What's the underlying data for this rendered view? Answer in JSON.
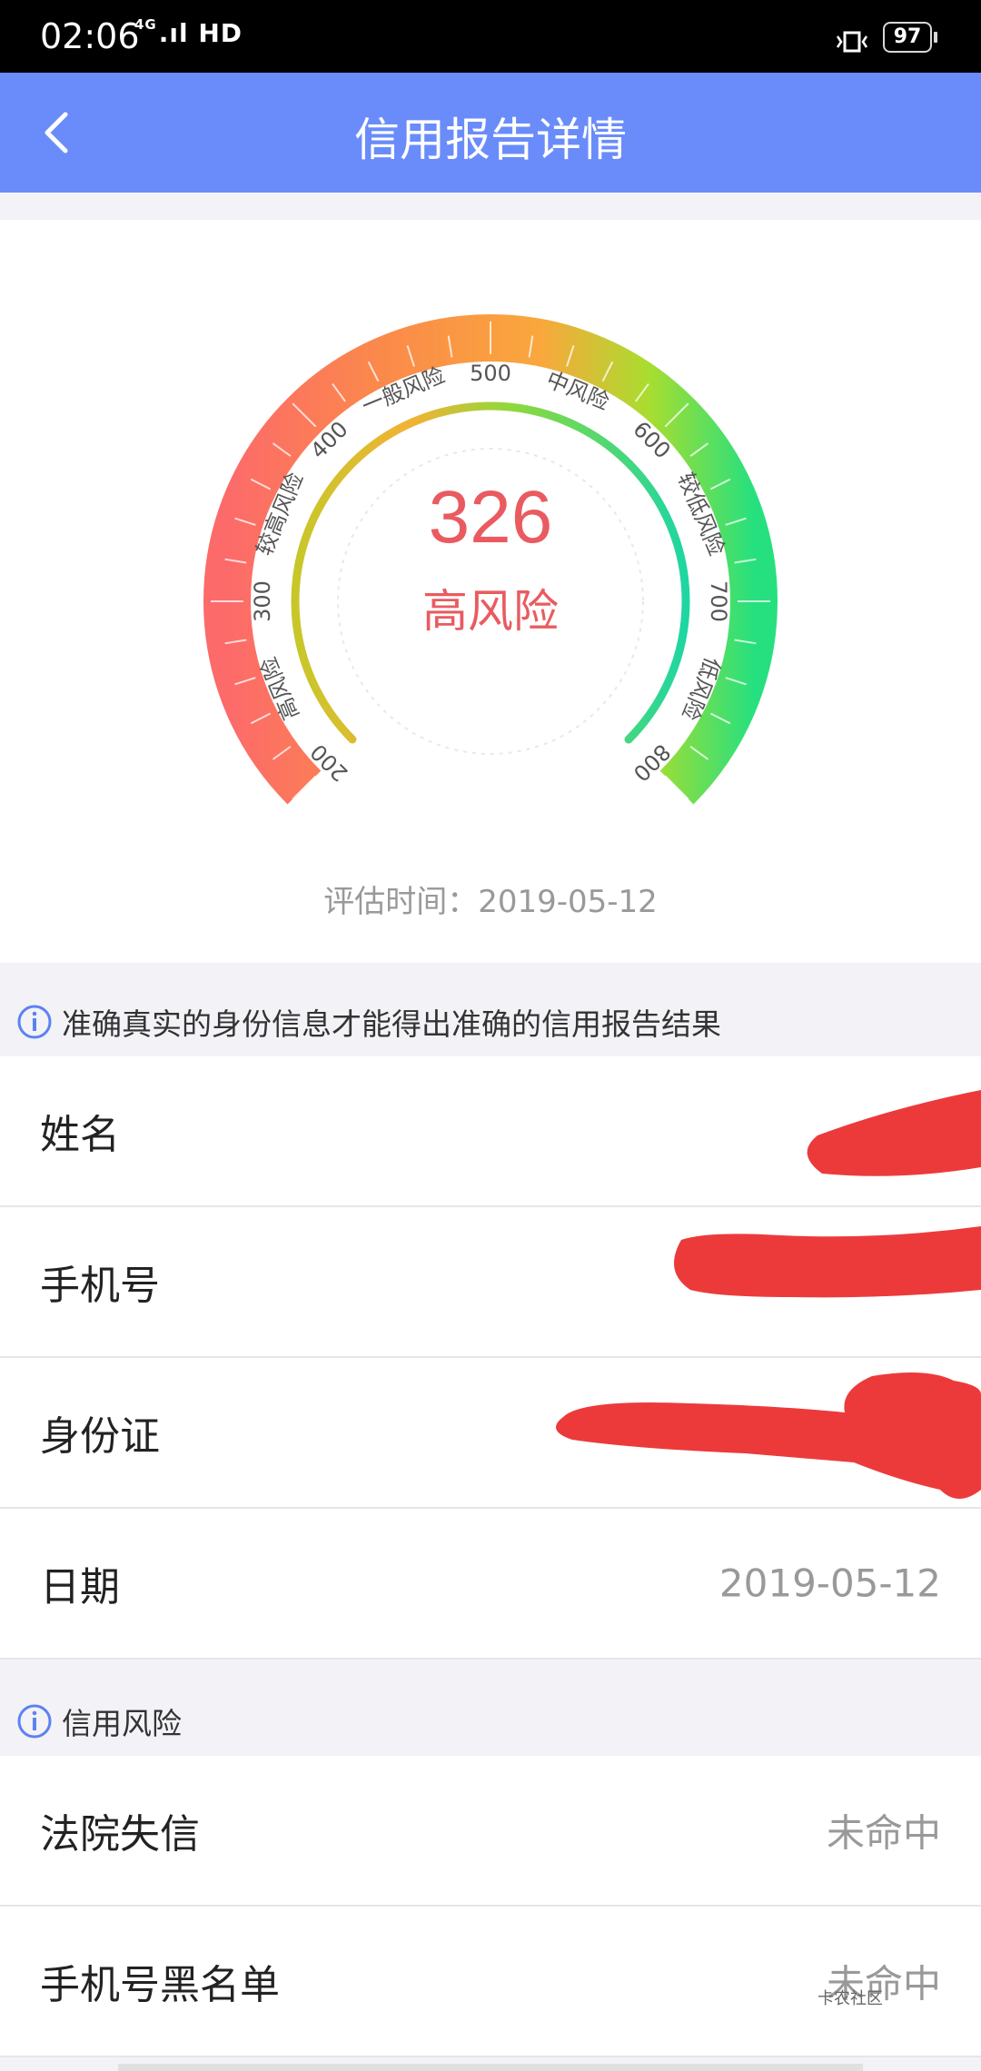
{
  "status": {
    "time": "02:06",
    "network": "4G",
    "hd": "HD",
    "battery": "97"
  },
  "header": {
    "title": "信用报告详情"
  },
  "gauge": {
    "score": "326",
    "risk": "高风险",
    "scale_ticks": [
      "200",
      "300",
      "400",
      "500",
      "600",
      "700",
      "800"
    ],
    "risk_bands": [
      "高风险",
      "较高风险",
      "一般风险",
      "中风险",
      "较低风险",
      "低风险"
    ],
    "eval_label": "评估时间：2019-05-12",
    "gradient_colors": [
      "#fb6e6e",
      "#fb9a44",
      "#f9b33d",
      "#a6e033",
      "#2fe27f"
    ]
  },
  "notice_identity": "准确真实的身份信息才能得出准确的信用报告结果",
  "identity_rows": [
    {
      "label": "姓名",
      "value": ""
    },
    {
      "label": "手机号",
      "value": ""
    },
    {
      "label": "身份证",
      "value": ""
    },
    {
      "label": "日期",
      "value": "2019-05-12"
    }
  ],
  "notice_risk": "信用风险",
  "risk_rows": [
    {
      "label": "法院失信",
      "value": "未命中"
    },
    {
      "label": "手机号黑名单",
      "value": "未命中"
    }
  ],
  "watermark": "卡农社区",
  "colors": {
    "header": "#6a8cfa",
    "score": "#e95b60",
    "redaction": "#ec3a3b"
  }
}
